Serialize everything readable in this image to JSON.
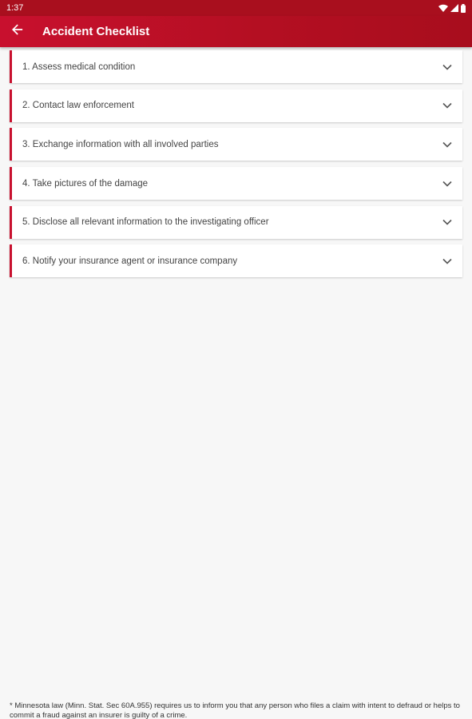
{
  "status_bar": {
    "time": "1:37",
    "icons": [
      "wifi-icon",
      "cell-signal-icon",
      "battery-icon"
    ]
  },
  "app_bar": {
    "title": "Accident Checklist",
    "back_icon": "arrow-back-icon",
    "colors": {
      "primary": "#c8102e",
      "dark": "#a90f1e"
    }
  },
  "checklist": {
    "items": [
      {
        "label": "1. Assess medical condition"
      },
      {
        "label": "2. Contact law enforcement"
      },
      {
        "label": "3. Exchange information with all involved parties"
      },
      {
        "label": "4. Take pictures of the damage"
      },
      {
        "label": "5. Disclose all relevant information to the investigating officer"
      },
      {
        "label": "6. Notify your insurance agent or insurance company"
      }
    ],
    "expand_icon": "chevron-down-icon"
  },
  "footer": {
    "text": "* Minnesota law (Minn. Stat. Sec 60A.955) requires us to inform you that any person who files a claim with intent to defraud or helps to commit a fraud against an insurer is guilty of a crime."
  }
}
